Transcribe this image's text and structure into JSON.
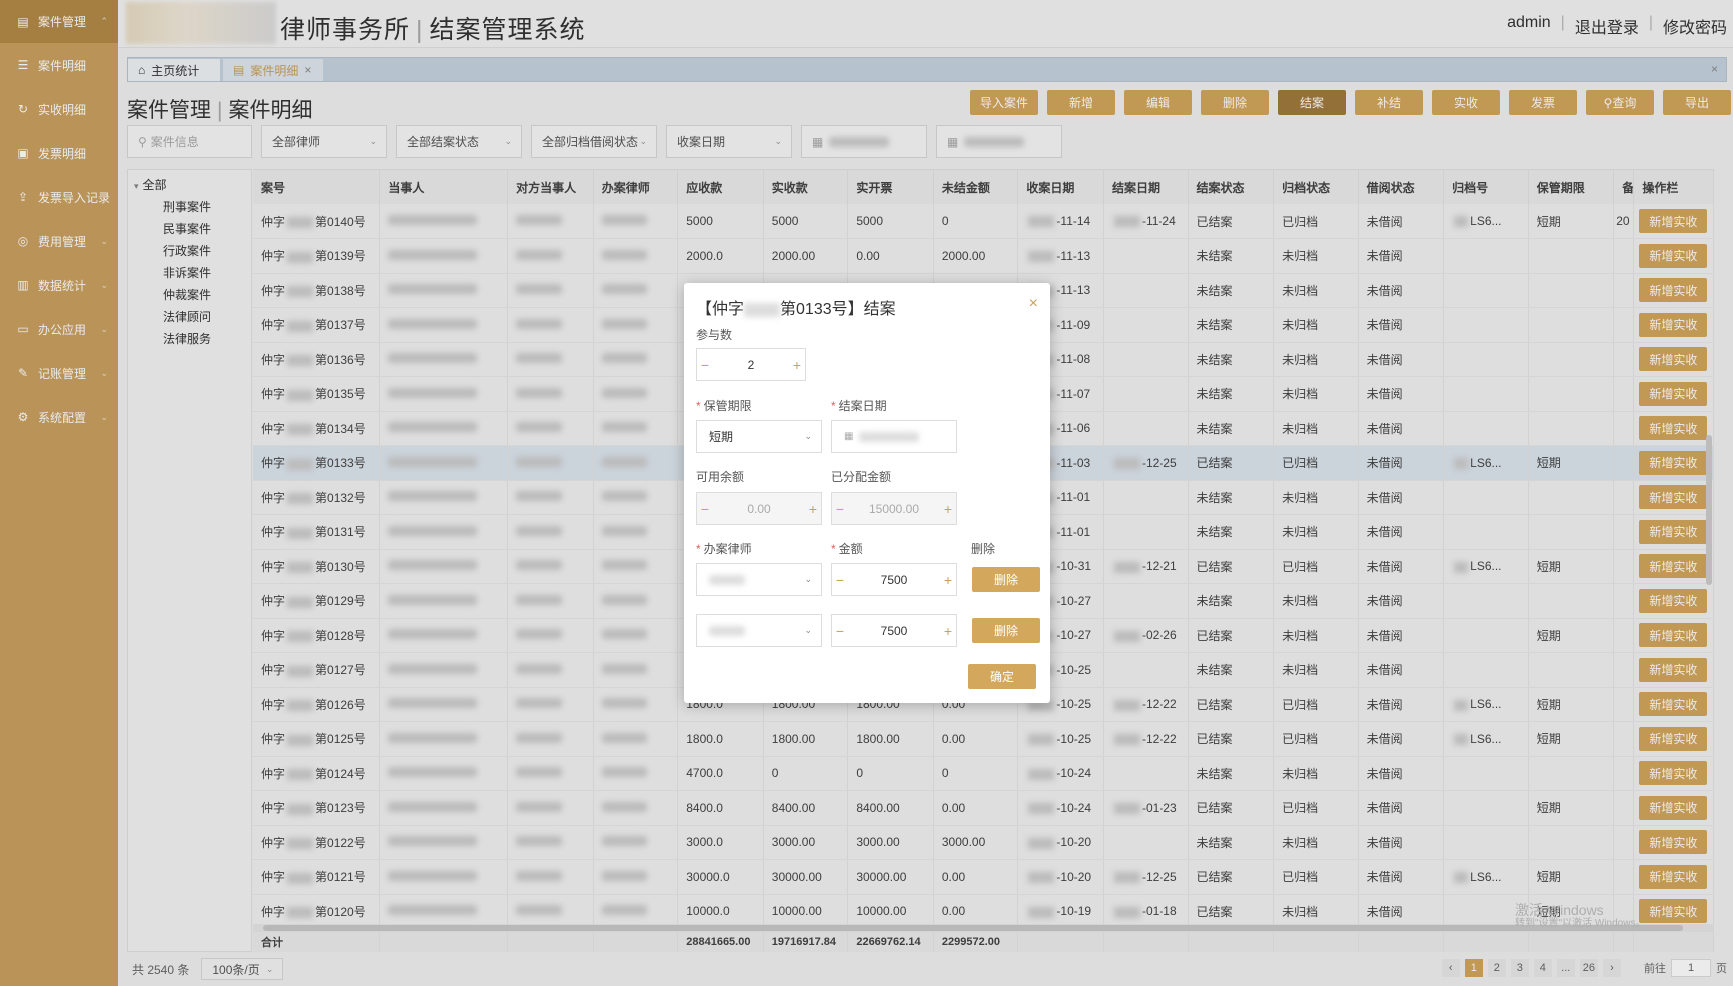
{
  "sidebar": {
    "items": [
      {
        "label": "案件管理",
        "icon": "case-icon",
        "arrow": "⌃"
      },
      {
        "label": "案件明细",
        "icon": "list-icon",
        "arrow": ""
      },
      {
        "label": "实收明细",
        "icon": "receipt-icon",
        "arrow": ""
      },
      {
        "label": "发票明细",
        "icon": "invoice-icon",
        "arrow": ""
      },
      {
        "label": "发票导入记录",
        "icon": "import-icon",
        "arrow": ""
      },
      {
        "label": "费用管理",
        "icon": "cost-icon",
        "arrow": "⌄"
      },
      {
        "label": "数据统计",
        "icon": "chart-icon",
        "arrow": "⌄"
      },
      {
        "label": "办公应用",
        "icon": "monitor-icon",
        "arrow": "⌄"
      },
      {
        "label": "记账管理",
        "icon": "ledger-icon",
        "arrow": "⌄"
      },
      {
        "label": "系统配置",
        "icon": "gear-icon",
        "arrow": "⌄"
      }
    ]
  },
  "header": {
    "title": "律师事务所",
    "subtitle": "结案管理系统",
    "user": "admin",
    "logout": "退出登录",
    "change_pwd": "修改密码"
  },
  "tabs": {
    "home": "主页统计",
    "current": "案件明细",
    "close": "×"
  },
  "page": {
    "title": "案件管理",
    "sub": "案件明细"
  },
  "toolbar": [
    "导入案件",
    "新增",
    "编辑",
    "删除",
    "结案",
    "补结",
    "实收",
    "发票",
    "查询",
    "导出"
  ],
  "filters": {
    "search_placeholder": "案件信息",
    "lawyer": "全部律师",
    "close_status": "全部结案状态",
    "archive_status": "全部归档借阅状态",
    "date_type": "收案日期"
  },
  "tree": {
    "root": "全部",
    "nodes": [
      "刑事案件",
      "民事案件",
      "行政案件",
      "非诉案件",
      "仲裁案件",
      "法律顾问",
      "法律服务"
    ]
  },
  "table": {
    "headers": [
      "案号",
      "当事人",
      "对方当事人",
      "办案律师",
      "应收款",
      "实收款",
      "实开票",
      "未结金额",
      "收案日期",
      "结案日期",
      "结案状态",
      "归档状态",
      "借阅状态",
      "归档号",
      "保管期限",
      "备",
      "操作栏"
    ],
    "action": "新增实收",
    "prefix": "仲字",
    "rows": [
      {
        "no": "第0140号",
        "ys": "5000",
        "ss": "5000",
        "kp": "5000",
        "wj": "0",
        "sa": "-11-14",
        "ja": "-11-24",
        "zt": "已结案",
        "gd": "已归档",
        "jy": "未借阅",
        "gdh": "LS6...",
        "bg": "短期",
        "bei": "20"
      },
      {
        "no": "第0139号",
        "ys": "2000.0",
        "ss": "2000.00",
        "kp": "0.00",
        "wj": "2000.00",
        "sa": "-11-13",
        "ja": "",
        "zt": "未结案",
        "gd": "未归档",
        "jy": "未借阅",
        "gdh": "",
        "bg": "",
        "bei": ""
      },
      {
        "no": "第0138号",
        "ys": "",
        "ss": "",
        "kp": "",
        "wj": "",
        "sa": "-11-13",
        "ja": "",
        "zt": "未结案",
        "gd": "未归档",
        "jy": "未借阅",
        "gdh": "",
        "bg": "",
        "bei": ""
      },
      {
        "no": "第0137号",
        "ys": "",
        "ss": "",
        "kp": "",
        "wj": "",
        "sa": "-11-09",
        "ja": "",
        "zt": "未结案",
        "gd": "未归档",
        "jy": "未借阅",
        "gdh": "",
        "bg": "",
        "bei": ""
      },
      {
        "no": "第0136号",
        "ys": "",
        "ss": "",
        "kp": "",
        "wj": "",
        "sa": "-11-08",
        "ja": "",
        "zt": "未结案",
        "gd": "未归档",
        "jy": "未借阅",
        "gdh": "",
        "bg": "",
        "bei": ""
      },
      {
        "no": "第0135号",
        "ys": "",
        "ss": "",
        "kp": "",
        "wj": "",
        "sa": "-11-07",
        "ja": "",
        "zt": "未结案",
        "gd": "未归档",
        "jy": "未借阅",
        "gdh": "",
        "bg": "",
        "bei": ""
      },
      {
        "no": "第0134号",
        "ys": "",
        "ss": "",
        "kp": "",
        "wj": "",
        "sa": "-11-06",
        "ja": "",
        "zt": "未结案",
        "gd": "未归档",
        "jy": "未借阅",
        "gdh": "",
        "bg": "",
        "bei": ""
      },
      {
        "no": "第0133号",
        "ys": "",
        "ss": "",
        "kp": "",
        "wj": "",
        "sa": "-11-03",
        "ja": "-12-25",
        "zt": "已结案",
        "gd": "已归档",
        "jy": "未借阅",
        "gdh": "LS6...",
        "bg": "短期",
        "bei": "",
        "sel": true
      },
      {
        "no": "第0132号",
        "ys": "",
        "ss": "",
        "kp": "",
        "wj": "",
        "sa": "-11-01",
        "ja": "",
        "zt": "未结案",
        "gd": "未归档",
        "jy": "未借阅",
        "gdh": "",
        "bg": "",
        "bei": ""
      },
      {
        "no": "第0131号",
        "ys": "",
        "ss": "",
        "kp": "",
        "wj": "",
        "sa": "-11-01",
        "ja": "",
        "zt": "未结案",
        "gd": "未归档",
        "jy": "未借阅",
        "gdh": "",
        "bg": "",
        "bei": ""
      },
      {
        "no": "第0130号",
        "ys": "",
        "ss": "",
        "kp": "",
        "wj": "",
        "sa": "-10-31",
        "ja": "-12-21",
        "zt": "已结案",
        "gd": "已归档",
        "jy": "未借阅",
        "gdh": "LS6...",
        "bg": "短期",
        "bei": ""
      },
      {
        "no": "第0129号",
        "ys": "",
        "ss": "",
        "kp": "",
        "wj": "",
        "sa": "-10-27",
        "ja": "",
        "zt": "未结案",
        "gd": "未归档",
        "jy": "未借阅",
        "gdh": "",
        "bg": "",
        "bei": ""
      },
      {
        "no": "第0128号",
        "ys": "",
        "ss": "",
        "kp": "",
        "wj": "",
        "sa": "-10-27",
        "ja": "-02-26",
        "zt": "已结案",
        "gd": "未归档",
        "jy": "未借阅",
        "gdh": "",
        "bg": "短期",
        "bei": ""
      },
      {
        "no": "第0127号",
        "ys": "",
        "ss": "",
        "kp": "",
        "wj": "",
        "sa": "-10-25",
        "ja": "",
        "zt": "未结案",
        "gd": "未归档",
        "jy": "未借阅",
        "gdh": "",
        "bg": "",
        "bei": ""
      },
      {
        "no": "第0126号",
        "ys": "1800.0",
        "ss": "1800.00",
        "kp": "1800.00",
        "wj": "0.00",
        "sa": "-10-25",
        "ja": "-12-22",
        "zt": "已结案",
        "gd": "已归档",
        "jy": "未借阅",
        "gdh": "LS6...",
        "bg": "短期",
        "bei": ""
      },
      {
        "no": "第0125号",
        "ys": "1800.0",
        "ss": "1800.00",
        "kp": "1800.00",
        "wj": "0.00",
        "sa": "-10-25",
        "ja": "-12-22",
        "zt": "已结案",
        "gd": "已归档",
        "jy": "未借阅",
        "gdh": "LS6...",
        "bg": "短期",
        "bei": ""
      },
      {
        "no": "第0124号",
        "ys": "4700.0",
        "ss": "0",
        "kp": "0",
        "wj": "0",
        "sa": "-10-24",
        "ja": "",
        "zt": "未结案",
        "gd": "未归档",
        "jy": "未借阅",
        "gdh": "",
        "bg": "",
        "bei": ""
      },
      {
        "no": "第0123号",
        "ys": "8400.0",
        "ss": "8400.00",
        "kp": "8400.00",
        "wj": "0.00",
        "sa": "-10-24",
        "ja": "-01-23",
        "zt": "已结案",
        "gd": "已归档",
        "jy": "未借阅",
        "gdh": "",
        "bg": "短期",
        "bei": ""
      },
      {
        "no": "第0122号",
        "ys": "3000.0",
        "ss": "3000.00",
        "kp": "3000.00",
        "wj": "3000.00",
        "sa": "-10-20",
        "ja": "",
        "zt": "未结案",
        "gd": "未归档",
        "jy": "未借阅",
        "gdh": "",
        "bg": "",
        "bei": ""
      },
      {
        "no": "第0121号",
        "ys": "30000.0",
        "ss": "30000.00",
        "kp": "30000.00",
        "wj": "0.00",
        "sa": "-10-20",
        "ja": "-12-25",
        "zt": "已结案",
        "gd": "已归档",
        "jy": "未借阅",
        "gdh": "LS6...",
        "bg": "短期",
        "bei": ""
      },
      {
        "no": "第0120号",
        "ys": "10000.0",
        "ss": "10000.00",
        "kp": "10000.00",
        "wj": "0.00",
        "sa": "-10-19",
        "ja": "-01-18",
        "zt": "已结案",
        "gd": "未归档",
        "jy": "未借阅",
        "gdh": "",
        "bg": "短期",
        "bei": ""
      }
    ],
    "sum": {
      "label": "合计",
      "ys": "28841665.00",
      "ss": "19716917.84",
      "kp": "22669762.14",
      "wj": "2299572.00"
    }
  },
  "footer": {
    "total": "共 2540 条",
    "page_size": "100条/页",
    "pages": [
      "1",
      "2",
      "3",
      "4",
      "...",
      "26"
    ],
    "goto": "前往",
    "goto_value": "1",
    "page_unit": "页",
    "prev": "‹",
    "next": "›"
  },
  "watermark": {
    "line1": "激活 Windows",
    "line2": "转到\"设置\"以激活 Windows。"
  },
  "modal": {
    "prefix": "【仲字",
    "title_suffix": "第0133号】结案",
    "close": "×",
    "participants_label": "参与数",
    "participants": "2",
    "retention_label": "保管期限",
    "retention": "短期",
    "close_date_label": "结案日期",
    "available_label": "可用余额",
    "available": "0.00",
    "allocated_label": "已分配金额",
    "allocated": "15000.00",
    "lawyer_label": "办案律师",
    "amount_label": "金额",
    "delete_label": "删除",
    "amount1": "7500",
    "amount2": "7500",
    "delete_btn": "删除",
    "confirm": "确定",
    "minus": "−",
    "plus": "+"
  }
}
